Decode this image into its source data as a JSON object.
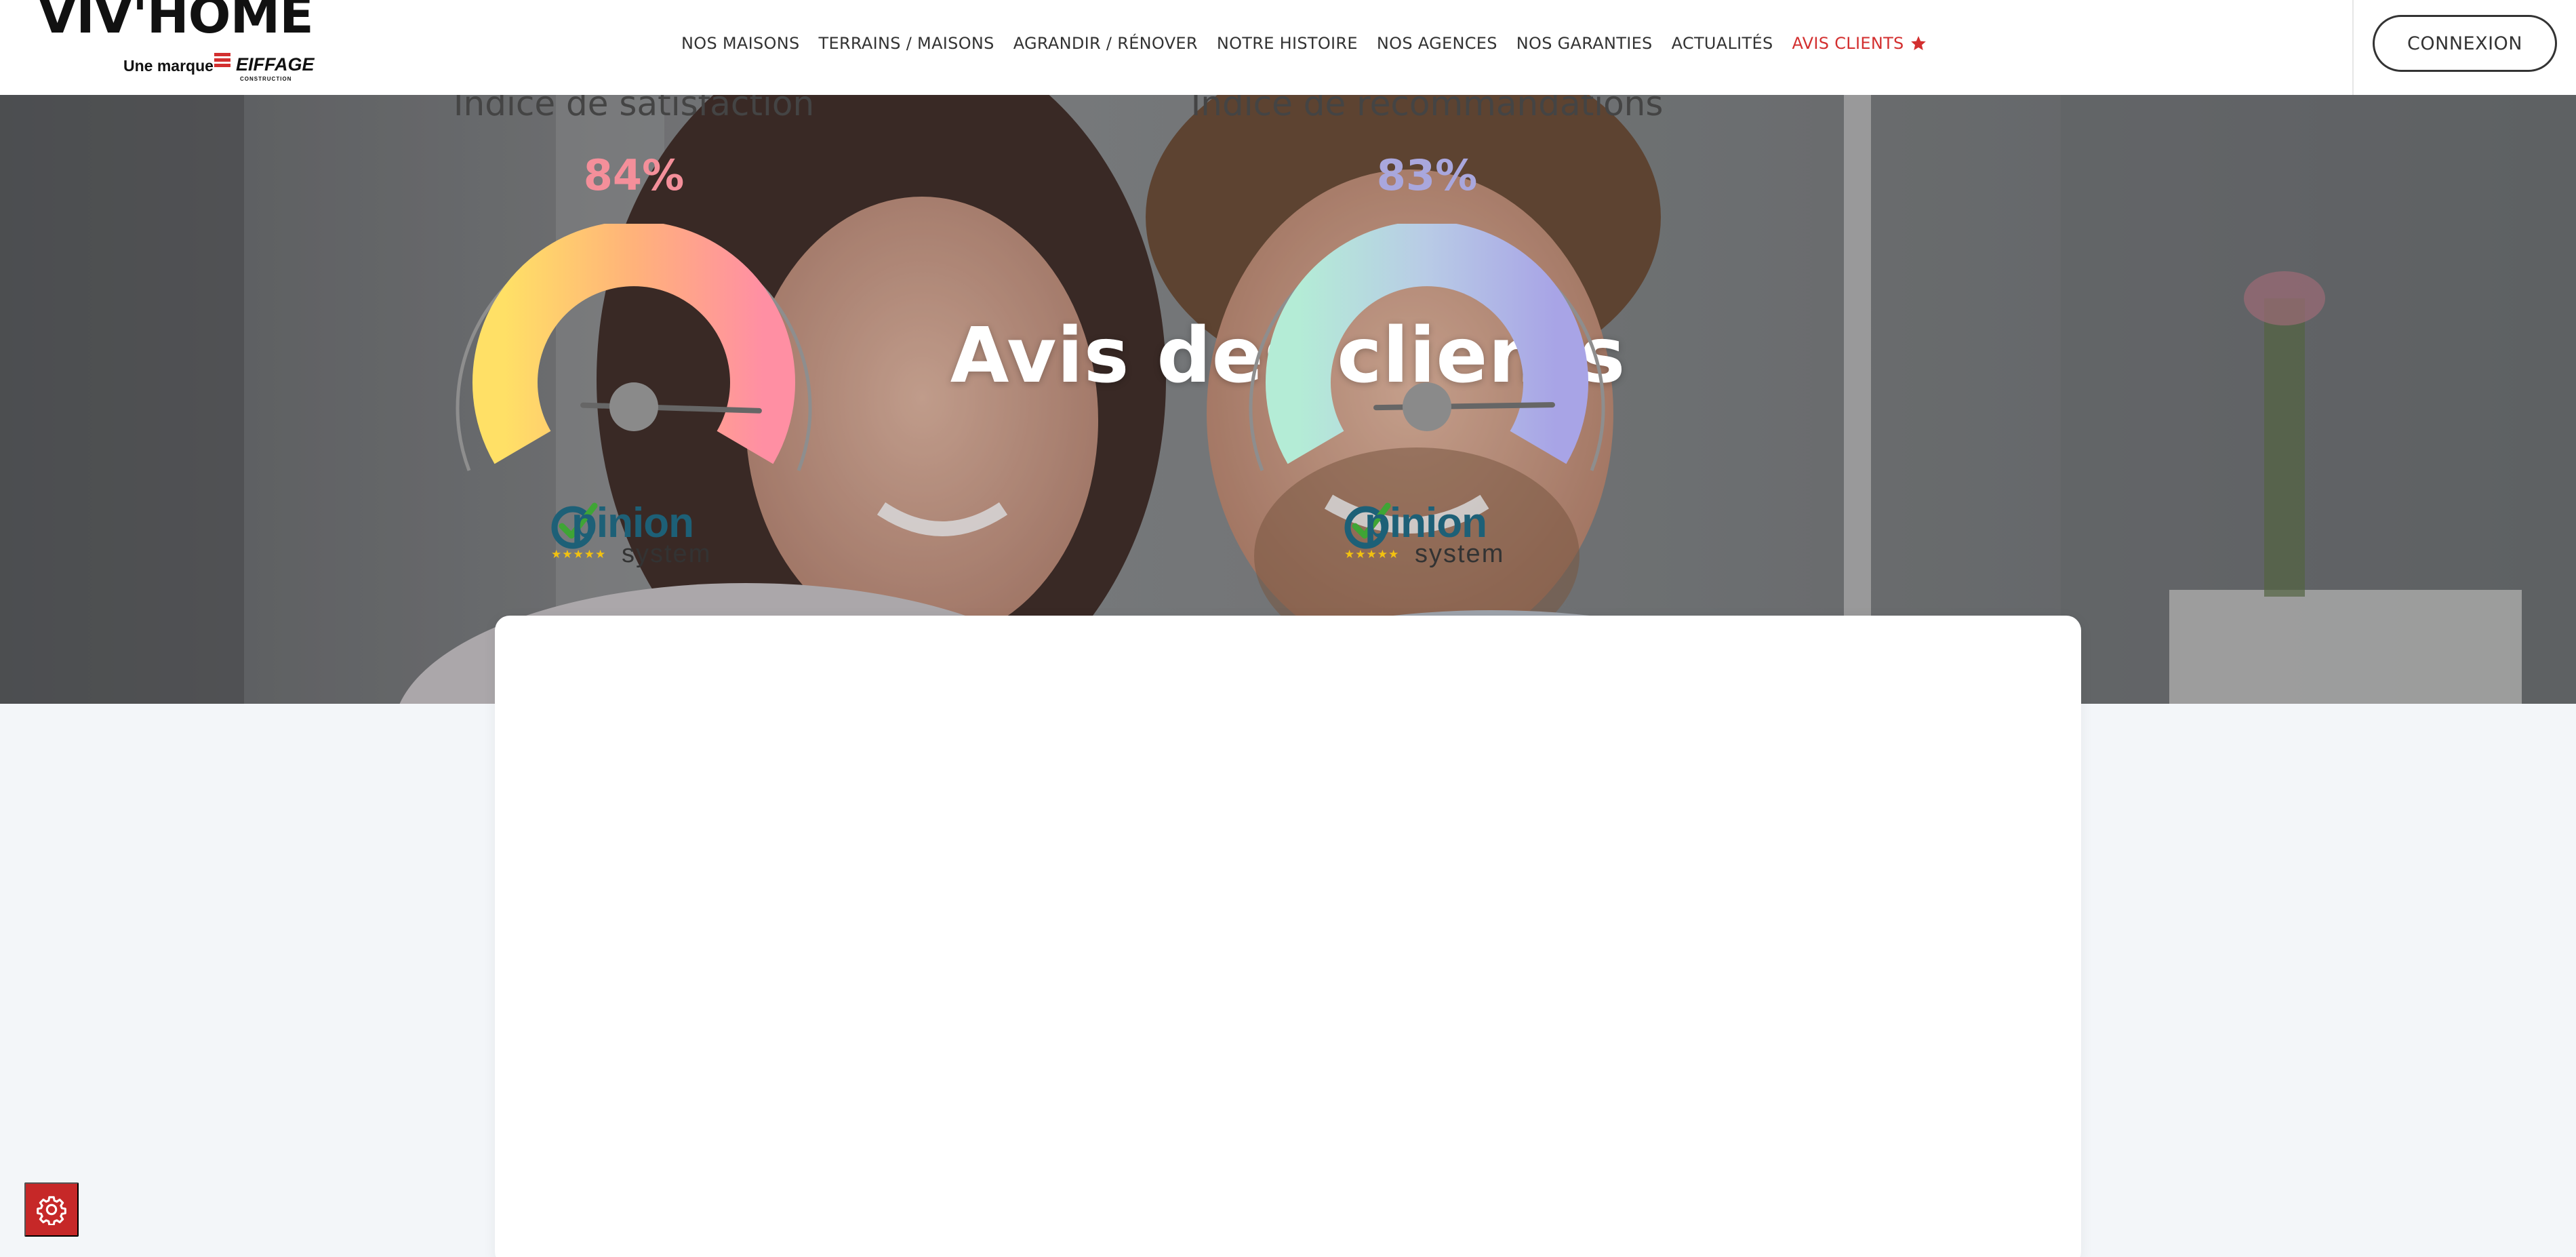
{
  "header": {
    "logo": {
      "brand": "VIV'HOME",
      "tagline": "Une marque",
      "partner": "EIFFAGE",
      "partner_sub": "CONSTRUCTION"
    },
    "nav": [
      {
        "label": "NOS MAISONS",
        "active": false
      },
      {
        "label": "TERRAINS / MAISONS",
        "active": false
      },
      {
        "label": "AGRANDIR / RÉNOVER",
        "active": false
      },
      {
        "label": "NOTRE HISTOIRE",
        "active": false
      },
      {
        "label": "NOS AGENCES",
        "active": false
      },
      {
        "label": "NOS GARANTIES",
        "active": false
      },
      {
        "label": "ACTUALITÉS",
        "active": false
      },
      {
        "label": "AVIS CLIENTS",
        "active": true,
        "icon": "star-icon"
      }
    ],
    "login_label": "CONNEXION"
  },
  "hero": {
    "title": "Avis des clients"
  },
  "indices": [
    {
      "title": "Indice de satisfaction",
      "value_text": "84%",
      "value": 84,
      "color": "#f48f9a",
      "gradient": [
        "#ffe066",
        "#ffb27a",
        "#ff8fa3"
      ]
    },
    {
      "title": "Indice de recommandations",
      "value_text": "83%",
      "value": 83,
      "color": "#a9a7dd",
      "gradient": [
        "#b4ecd6",
        "#b8cbe6",
        "#a8a4e6"
      ]
    }
  ],
  "opinion_system": {
    "word": "pinion",
    "sub": "system",
    "stars": "★★★★★"
  },
  "colors": {
    "accent": "#d32f2f",
    "text": "#333333",
    "page_bg": "#f3f6f9"
  },
  "cookie_button_icon": "gear-icon"
}
